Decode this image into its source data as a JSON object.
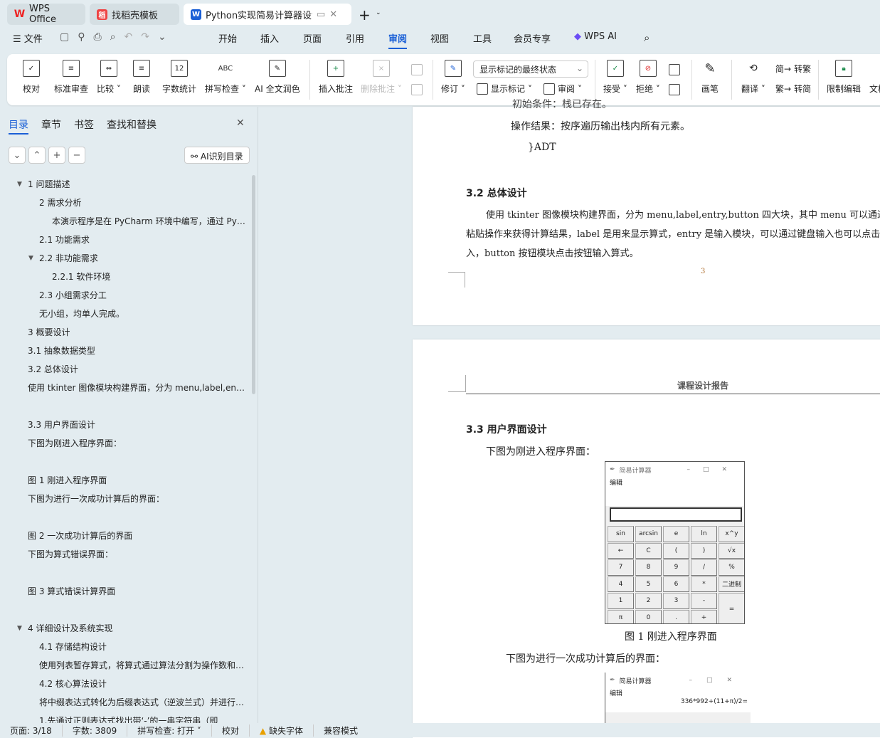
{
  "tabs": [
    {
      "label": "WPS Office"
    },
    {
      "label": "找稻壳模板"
    },
    {
      "label": "Python实现简易计算器设计 课"
    }
  ],
  "menu": {
    "file": "文件",
    "items": [
      "开始",
      "插入",
      "页面",
      "引用",
      "审阅",
      "视图",
      "工具",
      "会员专享"
    ],
    "wps_ai": "WPS AI",
    "active": "审阅"
  },
  "ribbon": {
    "proof": "校对",
    "std_review": "标准审查",
    "compare": "比较",
    "read": "朗读",
    "word_count": "字数统计",
    "spell": "拼写检查",
    "ai_polish": "AI 全文润色",
    "insert_comment": "插入批注",
    "delete_comment": "删除批注",
    "track": "修订",
    "markup_state": "显示标记的最终状态",
    "show_markup": "显示标记",
    "review": "审阅",
    "accept": "接受",
    "reject": "拒绝",
    "pen": "画笔",
    "translate": "翻译",
    "to_trad": "转繁",
    "to_simp": "转简",
    "restrict": "限制编辑",
    "doc": "文档"
  },
  "nav": {
    "tabs": [
      "目录",
      "章节",
      "书签",
      "查找和替换"
    ],
    "ai_toc": "AI识别目录",
    "outline": [
      {
        "text": "1  问题描述",
        "level": 1,
        "arrow": true
      },
      {
        "text": "2  需求分析",
        "level": 2
      },
      {
        "text": "本演示程序是在 PyCharm 环境中编写，通过 Py…",
        "level": 3
      },
      {
        "text": "2.1  功能需求",
        "level": 2
      },
      {
        "text": "2.2  非功能需求",
        "level": 2,
        "arrow": true
      },
      {
        "text": "2.2.1 软件环境",
        "level": 3
      },
      {
        "text": "2.3  小组需求分工",
        "level": 2
      },
      {
        "text": "无小组，均单人完成。",
        "level": 2
      },
      {
        "text": "3  概要设计",
        "level": 1
      },
      {
        "text": "3.1 抽象数据类型",
        "level": 1
      },
      {
        "text": "3.2  总体设计",
        "level": 1
      },
      {
        "text": "使用 tkinter 图像模块构建界面，分为 menu,label,ent…",
        "level": 1
      },
      {
        "text": "",
        "level": 1
      },
      {
        "text": "3.3  用户界面设计",
        "level": 1
      },
      {
        "text": "下图为刚进入程序界面：",
        "level": 1
      },
      {
        "text": "",
        "level": 1
      },
      {
        "text": "图 1  刚进入程序界面",
        "level": 1
      },
      {
        "text": "下图为进行一次成功计算后的界面：",
        "level": 1
      },
      {
        "text": "",
        "level": 1
      },
      {
        "text": "图 2  一次成功计算后的界面",
        "level": 1
      },
      {
        "text": "下图为算式错误界面：",
        "level": 1
      },
      {
        "text": "",
        "level": 1
      },
      {
        "text": "图 3  算式错误计算界面",
        "level": 1
      },
      {
        "text": "",
        "level": 1
      },
      {
        "text": "4  详细设计及系统实现",
        "level": 1,
        "arrow": true
      },
      {
        "text": "4.1  存储结构设计",
        "level": 2
      },
      {
        "text": "使用列表暂存算式，将算式通过算法分割为操作数和…",
        "level": 2
      },
      {
        "text": "4.2  核心算法设计",
        "level": 2
      },
      {
        "text": "将中缀表达式转化为后缀表达式（逆波兰式）并进行…",
        "level": 2
      },
      {
        "text": "1.先通过正则表达式找出带‘-’的一串字符串（即",
        "level": 2
      }
    ]
  },
  "doc": {
    "p1_cut": "初始条件：栈已存在。",
    "p1_result": "操作结果：按序遍历输出栈内所有元素。",
    "p1_adt": "}ADT",
    "h32": "3.2  总体设计",
    "p32": [
      "使用 tkinter 图像模块构建界面，分为 menu,label,entry,button 四大块，其中 menu 可以通过复制",
      "粘贴操作来获得计算结果，label 是用来显示算式，entry 是输入模块，可以通过键盘输入也可以点击按钮输",
      "入，button 按钮模块点击按钮输入算式。"
    ],
    "page_num": "3",
    "header": "课程设计报告",
    "h33": "3.3  用户界面设计",
    "p33": "下图为刚进入程序界面：",
    "fig1": "图 1  刚进入程序界面",
    "p_after": "下图为进行一次成功计算后的界面："
  },
  "calc": {
    "title": "简易计算器",
    "menu": "编辑",
    "expr": "336*992+(11+π)/2=",
    "buttons": [
      "sin",
      "arcsin",
      "e",
      "ln",
      "x^y",
      "←",
      "C",
      "(",
      ")",
      "√x",
      "7",
      "8",
      "9",
      "/",
      "%",
      "4",
      "5",
      "6",
      "*",
      "二进制",
      "1",
      "2",
      "3",
      "-",
      "=",
      "π",
      "0",
      ".",
      "+"
    ]
  },
  "status": {
    "page": "页面: 3/18",
    "words": "字数: 3809",
    "spell": "拼写检查: 打开",
    "proof": "校对",
    "missing_font": "缺失字体",
    "compat": "兼容模式"
  }
}
